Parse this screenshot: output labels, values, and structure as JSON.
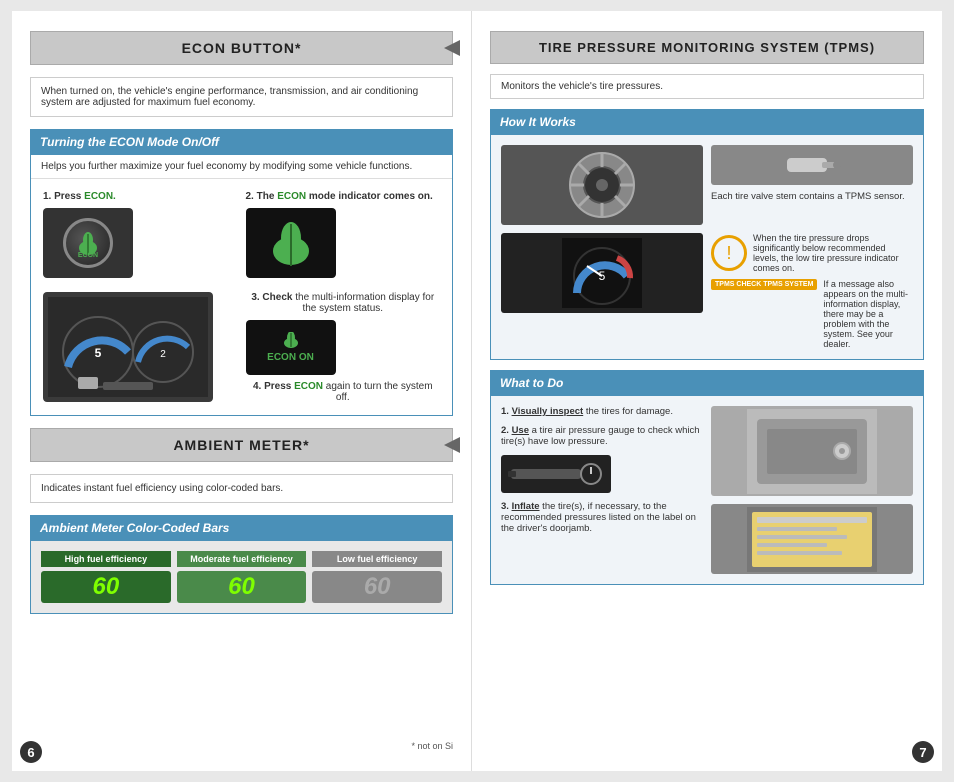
{
  "left": {
    "econ_title": "ECON BUTTON*",
    "econ_desc": "When turned on, the vehicle's engine performance, transmission, and air conditioning system are adjusted for maximum fuel economy.",
    "turning_econ_header": "Turning the ECON Mode On/Off",
    "turning_econ_desc": "Helps you further maximize your fuel economy by modifying some vehicle functions.",
    "step1_label": "1. Press ECON.",
    "step2_label": "2. The ECON mode indicator comes on.",
    "step3_label": "3. Check the multi-information display for the system status.",
    "step4_label": "4. Press ECON again to turn the system off.",
    "econ_on_text": "ECON ON",
    "ambient_title": "AMBIENT METER*",
    "ambient_desc": "Indicates instant fuel efficiency using color-coded bars.",
    "ambient_bars_header": "Ambient Meter Color-Coded Bars",
    "bar_high_label": "High fuel efficiency",
    "bar_high_num": "60",
    "bar_moderate_label": "Moderate fuel efficiency",
    "bar_moderate_num": "60",
    "bar_low_label": "Low fuel efficiency",
    "bar_low_num": "60",
    "footnote": "* not on Si",
    "page_num_left": "6"
  },
  "right": {
    "tpms_title": "TIRE PRESSURE MONITORING SYSTEM (TPMS)",
    "tpms_desc": "Monitors the vehicle's tire pressures.",
    "how_it_works_header": "How It Works",
    "tpms_text1": "Each tire valve stem contains a TPMS sensor.",
    "tpms_text2": "When the tire pressure drops significantly below recommended levels, the low tire pressure indicator comes on.",
    "tpms_text3": "If a message also appears on the multi-information display, there may be a problem with the system. See your dealer.",
    "what_to_do_header": "What to Do",
    "step1_visually": "1. Visually inspect",
    "step1_rest": " the tires for damage.",
    "step2_use": "2. Use",
    "step2_rest": " a tire air pressure gauge to check which tire(s) have low pressure.",
    "step3_inflate": "3. Inflate",
    "step3_rest": " the tire(s), if necessary, to the recommended pressures listed on the label on the driver's doorjamb.",
    "page_num_right": "7"
  }
}
